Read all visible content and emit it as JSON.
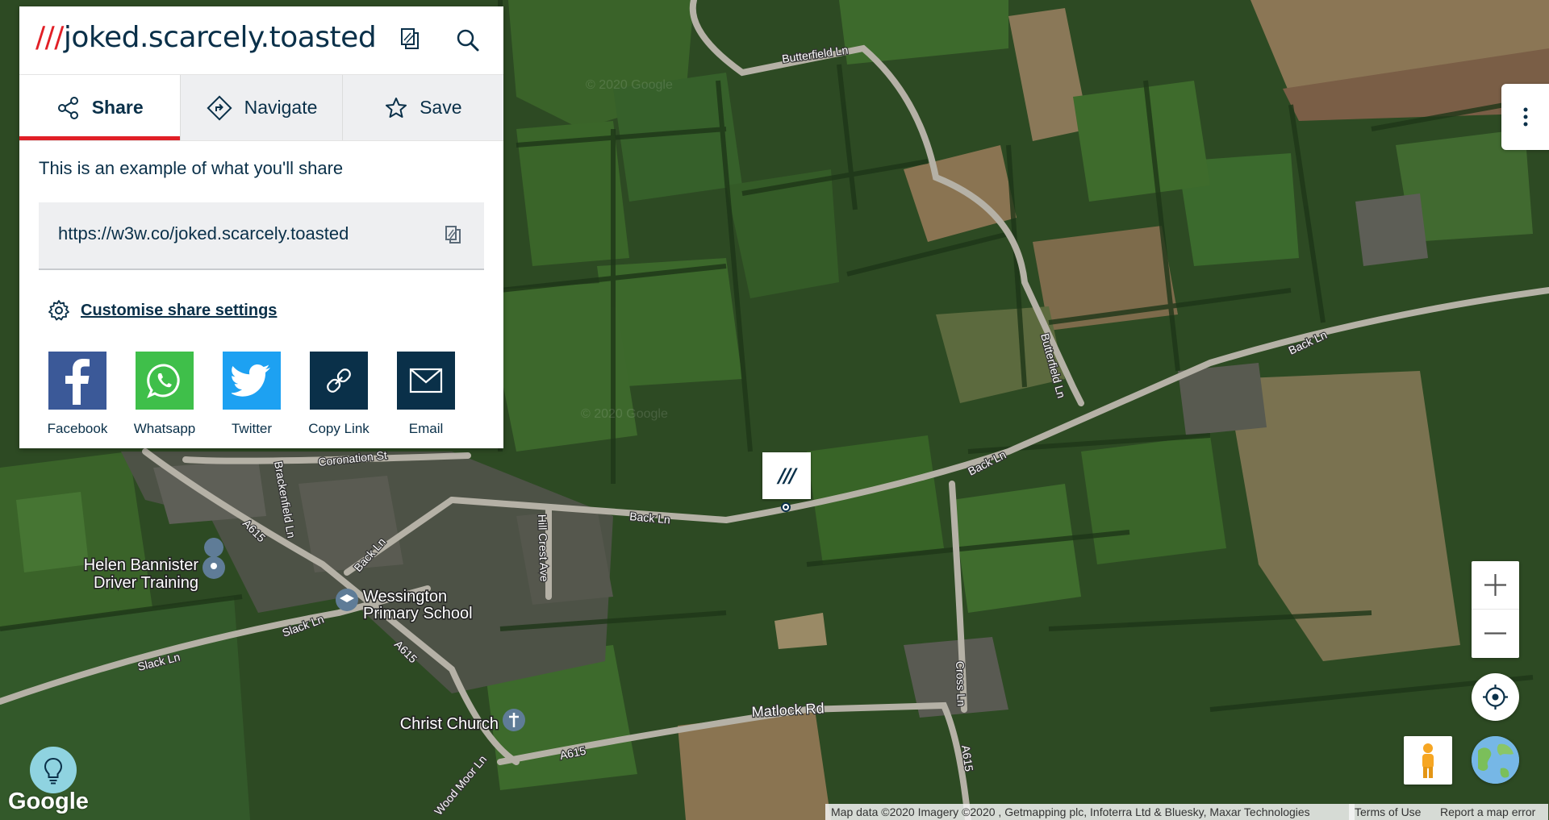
{
  "header": {
    "slashes": "///",
    "three_words": "joked.scarcely.toasted"
  },
  "tabs": [
    {
      "label": "Share",
      "icon": "share-icon",
      "active": true
    },
    {
      "label": "Navigate",
      "icon": "navigate-icon",
      "active": false
    },
    {
      "label": "Save",
      "icon": "star-icon",
      "active": false
    }
  ],
  "share": {
    "description": "This is an example of what you'll share",
    "url": "https://w3w.co/joked.scarcely.toasted",
    "settings_label": "Customise share settings",
    "buttons": [
      {
        "label": "Facebook",
        "color": "#3b5998"
      },
      {
        "label": "Whatsapp",
        "color": "#3fbf4a"
      },
      {
        "label": "Twitter",
        "color": "#1da1f2"
      },
      {
        "label": "Copy Link",
        "color": "#0a3049"
      },
      {
        "label": "Email",
        "color": "#0a3049"
      }
    ]
  },
  "marker": {
    "text": "///"
  },
  "map_labels": {
    "butterfield_ln": "Butterfield Ln",
    "back_ln": "Back Ln",
    "coronation_st": "Coronation St",
    "brackenfield_ln": "Brackenfield Ln",
    "hill_crest_ave": "Hill Crest Ave",
    "a615": "A615",
    "slack_ln": "Slack Ln",
    "matlock_rd": "Matlock Rd",
    "cross_ln": "Cross Ln",
    "wood_moor_ln": "Wood Moor Ln"
  },
  "pois": {
    "driver_training_line1": "Helen Bannister",
    "driver_training_line2": "Driver Training",
    "school_line1": "Wessington",
    "school_line2": "Primary School",
    "church": "Christ Church"
  },
  "watermark": "© 2020 Google",
  "google_logo": "Google",
  "attribution": {
    "map_data": "Map data ©2020 Imagery ©2020 , Getmapping plc, Infoterra Ltd & Bluesky, Maxar Technologies",
    "terms": "Terms of Use",
    "report": "Report a map error"
  },
  "colors": {
    "w3w_red": "#e11f26",
    "w3w_navy": "#0a3049",
    "field_dark": "#2a4a20",
    "field_light": "#3d6a2c",
    "field_brown": "#7a6a4e",
    "road": "#b8b3a8"
  }
}
